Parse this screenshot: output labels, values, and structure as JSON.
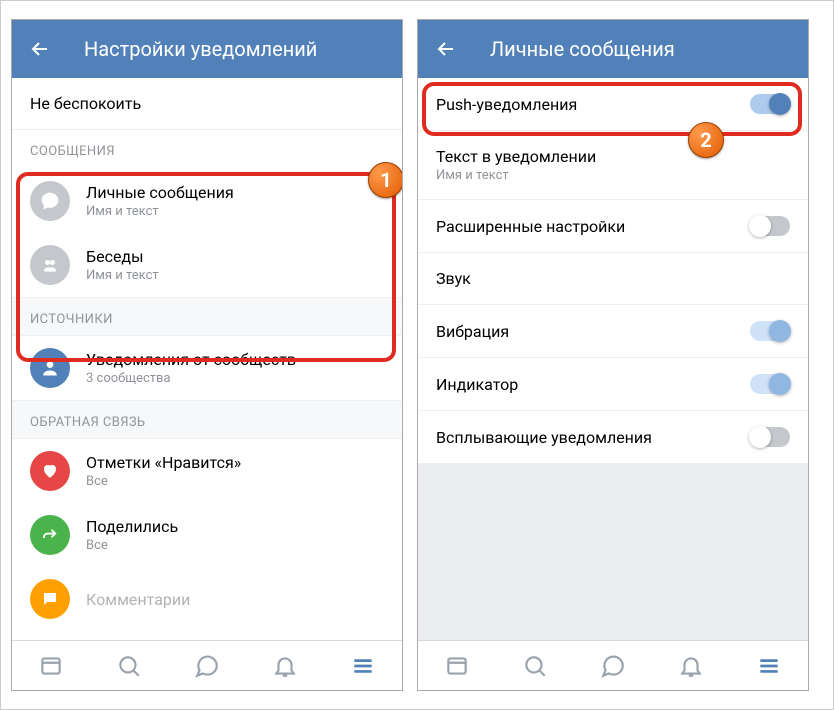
{
  "left": {
    "title": "Настройки уведомлений",
    "dnd": "Не беспокоить",
    "sections": {
      "messages": {
        "header": "СООБЩЕНИЯ",
        "personal": {
          "title": "Личные сообщения",
          "sub": "Имя и текст"
        },
        "chats": {
          "title": "Беседы",
          "sub": "Имя и текст"
        }
      },
      "sources": {
        "header": "ИСТОЧНИКИ",
        "communities": {
          "title": "Уведомления от сообществ",
          "sub": "3 сообщества"
        }
      },
      "feedback": {
        "header": "ОБРАТНАЯ СВЯЗЬ",
        "likes": {
          "title": "Отметки «Нравится»",
          "sub": "Все"
        },
        "shares": {
          "title": "Поделились",
          "sub": "Все"
        },
        "comments": {
          "title": "Комментарии"
        }
      }
    }
  },
  "right": {
    "title": "Личные сообщения",
    "push": "Push-уведомления",
    "text_in_notif": {
      "title": "Текст в уведомлении",
      "sub": "Имя и текст"
    },
    "advanced": "Расширенные настройки",
    "sound": "Звук",
    "vibration": "Вибрация",
    "indicator": "Индикатор",
    "popup": "Всплывающие уведомления"
  },
  "badges": {
    "b1": "1",
    "b2": "2"
  }
}
